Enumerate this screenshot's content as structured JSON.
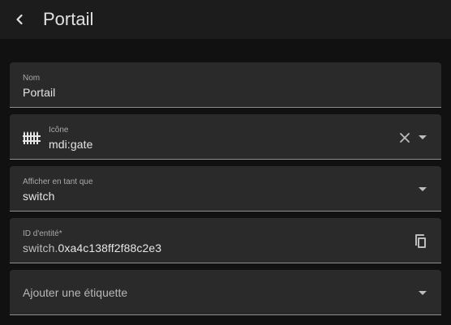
{
  "header": {
    "title": "Portail"
  },
  "form": {
    "name": {
      "label": "Nom",
      "value": "Portail"
    },
    "icon": {
      "label": "Icône",
      "value": "mdi:gate",
      "icon_name": "gate-icon"
    },
    "show_as": {
      "label": "Afficher en tant que",
      "value": "switch"
    },
    "entity_id": {
      "label": "ID d'entité*",
      "prefix": "switch.",
      "value": "0xa4c138ff2f88c2e3"
    },
    "label_field": {
      "placeholder": "Ajouter une étiquette"
    }
  },
  "colors": {
    "background": "#111111",
    "header_bg": "#1c1c1c",
    "field_bg": "#2a2a2a",
    "text": "#e1e1e1",
    "secondary_text": "#a9a9a9"
  }
}
